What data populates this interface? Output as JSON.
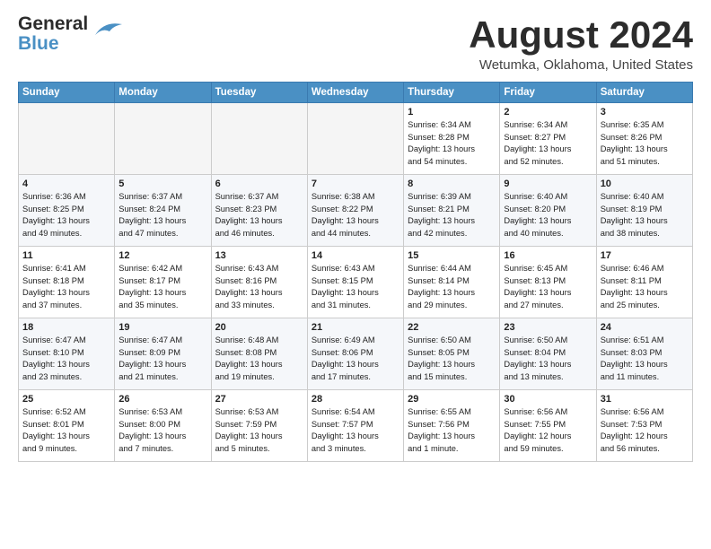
{
  "header": {
    "logo_line1": "General",
    "logo_line2": "Blue",
    "month": "August 2024",
    "location": "Wetumka, Oklahoma, United States"
  },
  "weekdays": [
    "Sunday",
    "Monday",
    "Tuesday",
    "Wednesday",
    "Thursday",
    "Friday",
    "Saturday"
  ],
  "weeks": [
    [
      {
        "day": "",
        "info": ""
      },
      {
        "day": "",
        "info": ""
      },
      {
        "day": "",
        "info": ""
      },
      {
        "day": "",
        "info": ""
      },
      {
        "day": "1",
        "info": "Sunrise: 6:34 AM\nSunset: 8:28 PM\nDaylight: 13 hours\nand 54 minutes."
      },
      {
        "day": "2",
        "info": "Sunrise: 6:34 AM\nSunset: 8:27 PM\nDaylight: 13 hours\nand 52 minutes."
      },
      {
        "day": "3",
        "info": "Sunrise: 6:35 AM\nSunset: 8:26 PM\nDaylight: 13 hours\nand 51 minutes."
      }
    ],
    [
      {
        "day": "4",
        "info": "Sunrise: 6:36 AM\nSunset: 8:25 PM\nDaylight: 13 hours\nand 49 minutes."
      },
      {
        "day": "5",
        "info": "Sunrise: 6:37 AM\nSunset: 8:24 PM\nDaylight: 13 hours\nand 47 minutes."
      },
      {
        "day": "6",
        "info": "Sunrise: 6:37 AM\nSunset: 8:23 PM\nDaylight: 13 hours\nand 46 minutes."
      },
      {
        "day": "7",
        "info": "Sunrise: 6:38 AM\nSunset: 8:22 PM\nDaylight: 13 hours\nand 44 minutes."
      },
      {
        "day": "8",
        "info": "Sunrise: 6:39 AM\nSunset: 8:21 PM\nDaylight: 13 hours\nand 42 minutes."
      },
      {
        "day": "9",
        "info": "Sunrise: 6:40 AM\nSunset: 8:20 PM\nDaylight: 13 hours\nand 40 minutes."
      },
      {
        "day": "10",
        "info": "Sunrise: 6:40 AM\nSunset: 8:19 PM\nDaylight: 13 hours\nand 38 minutes."
      }
    ],
    [
      {
        "day": "11",
        "info": "Sunrise: 6:41 AM\nSunset: 8:18 PM\nDaylight: 13 hours\nand 37 minutes."
      },
      {
        "day": "12",
        "info": "Sunrise: 6:42 AM\nSunset: 8:17 PM\nDaylight: 13 hours\nand 35 minutes."
      },
      {
        "day": "13",
        "info": "Sunrise: 6:43 AM\nSunset: 8:16 PM\nDaylight: 13 hours\nand 33 minutes."
      },
      {
        "day": "14",
        "info": "Sunrise: 6:43 AM\nSunset: 8:15 PM\nDaylight: 13 hours\nand 31 minutes."
      },
      {
        "day": "15",
        "info": "Sunrise: 6:44 AM\nSunset: 8:14 PM\nDaylight: 13 hours\nand 29 minutes."
      },
      {
        "day": "16",
        "info": "Sunrise: 6:45 AM\nSunset: 8:13 PM\nDaylight: 13 hours\nand 27 minutes."
      },
      {
        "day": "17",
        "info": "Sunrise: 6:46 AM\nSunset: 8:11 PM\nDaylight: 13 hours\nand 25 minutes."
      }
    ],
    [
      {
        "day": "18",
        "info": "Sunrise: 6:47 AM\nSunset: 8:10 PM\nDaylight: 13 hours\nand 23 minutes."
      },
      {
        "day": "19",
        "info": "Sunrise: 6:47 AM\nSunset: 8:09 PM\nDaylight: 13 hours\nand 21 minutes."
      },
      {
        "day": "20",
        "info": "Sunrise: 6:48 AM\nSunset: 8:08 PM\nDaylight: 13 hours\nand 19 minutes."
      },
      {
        "day": "21",
        "info": "Sunrise: 6:49 AM\nSunset: 8:06 PM\nDaylight: 13 hours\nand 17 minutes."
      },
      {
        "day": "22",
        "info": "Sunrise: 6:50 AM\nSunset: 8:05 PM\nDaylight: 13 hours\nand 15 minutes."
      },
      {
        "day": "23",
        "info": "Sunrise: 6:50 AM\nSunset: 8:04 PM\nDaylight: 13 hours\nand 13 minutes."
      },
      {
        "day": "24",
        "info": "Sunrise: 6:51 AM\nSunset: 8:03 PM\nDaylight: 13 hours\nand 11 minutes."
      }
    ],
    [
      {
        "day": "25",
        "info": "Sunrise: 6:52 AM\nSunset: 8:01 PM\nDaylight: 13 hours\nand 9 minutes."
      },
      {
        "day": "26",
        "info": "Sunrise: 6:53 AM\nSunset: 8:00 PM\nDaylight: 13 hours\nand 7 minutes."
      },
      {
        "day": "27",
        "info": "Sunrise: 6:53 AM\nSunset: 7:59 PM\nDaylight: 13 hours\nand 5 minutes."
      },
      {
        "day": "28",
        "info": "Sunrise: 6:54 AM\nSunset: 7:57 PM\nDaylight: 13 hours\nand 3 minutes."
      },
      {
        "day": "29",
        "info": "Sunrise: 6:55 AM\nSunset: 7:56 PM\nDaylight: 13 hours\nand 1 minute."
      },
      {
        "day": "30",
        "info": "Sunrise: 6:56 AM\nSunset: 7:55 PM\nDaylight: 12 hours\nand 59 minutes."
      },
      {
        "day": "31",
        "info": "Sunrise: 6:56 AM\nSunset: 7:53 PM\nDaylight: 12 hours\nand 56 minutes."
      }
    ]
  ]
}
